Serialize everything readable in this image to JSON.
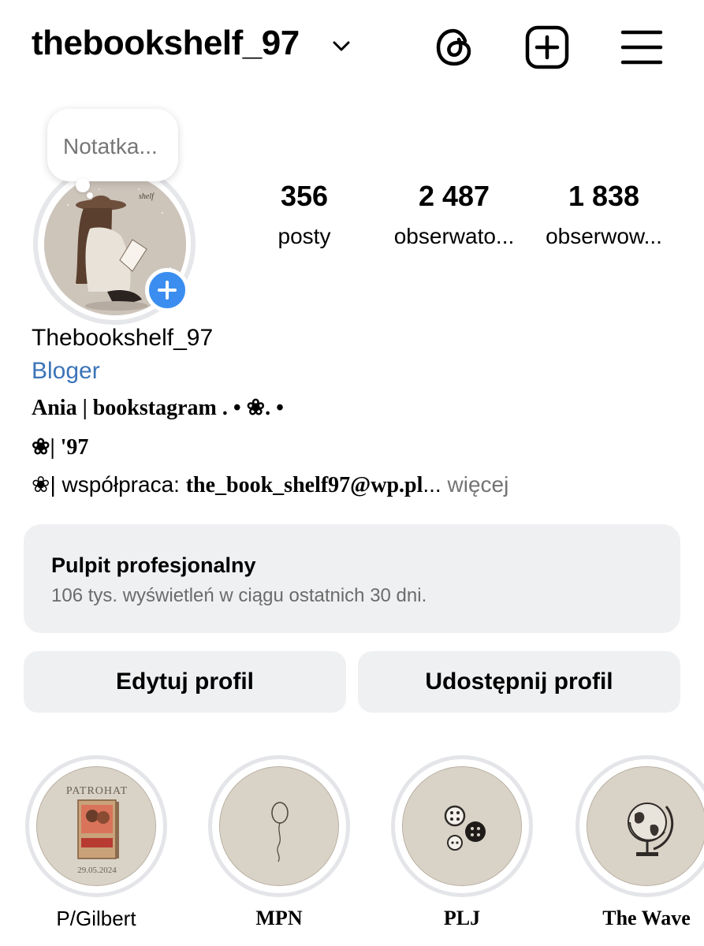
{
  "header": {
    "username": "thebookshelf_97",
    "icons": [
      "chevron-down-icon",
      "threads-icon",
      "add-post-icon",
      "menu-icon"
    ]
  },
  "note": {
    "placeholder": "Notatka..."
  },
  "stats": [
    {
      "value": "356",
      "label": "posty"
    },
    {
      "value": "2 487",
      "label": "obserwato..."
    },
    {
      "value": "1 838",
      "label": "obserwow..."
    }
  ],
  "profile": {
    "display_name": "Thebookshelf_97",
    "category": "Bloger",
    "bio_line1": "Ania | bookstagram . • ❀. •",
    "bio_line2": "❀| '97",
    "bio_line3_prefix": "❀| współpraca: ",
    "bio_line3_email": "the_book_shelf97@wp.pl",
    "bio_line3_ellipsis": "...",
    "more": " więcej"
  },
  "dashboard": {
    "title": "Pulpit profesjonalny",
    "subtitle": "106 tys. wyświetleń w ciągu ostatnich 30 dni."
  },
  "buttons": {
    "edit": "Edytuj profil",
    "share": "Udostępnij profil"
  },
  "highlights": [
    {
      "label": "P/Gilbert",
      "cover_text_top": "PATROHAT",
      "cover_text_bottom": "29.05.2024",
      "icon": "book-cover-icon"
    },
    {
      "label": "MPN",
      "icon": "balloon-icon"
    },
    {
      "label": "PLJ",
      "icon": "buttons-icon"
    },
    {
      "label": "The Wave",
      "icon": "globe-icon"
    }
  ],
  "colors": {
    "accent_blue": "#3b8ef0",
    "category_blue": "#3b74b8",
    "panel_gray": "#eff0f2",
    "highlight_bg": "#d8d1c5"
  }
}
